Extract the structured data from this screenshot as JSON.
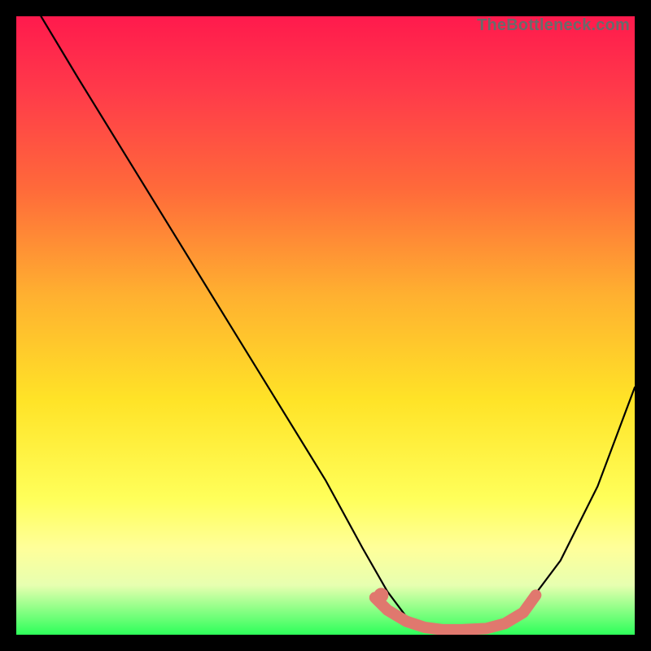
{
  "watermark": "TheBottleneck.com",
  "chart_data": {
    "type": "line",
    "title": "",
    "xlabel": "",
    "ylabel": "",
    "xlim": [
      0,
      100
    ],
    "ylim": [
      0,
      100
    ],
    "series": [
      {
        "name": "curve",
        "x": [
          4,
          10,
          18,
          26,
          34,
          42,
          50,
          56,
          60,
          63,
          66,
          70,
          74,
          78,
          82,
          88,
          94,
          100
        ],
        "y": [
          100,
          90,
          77,
          64,
          51,
          38,
          25,
          14,
          7,
          3,
          1,
          0.5,
          0.5,
          1,
          4,
          12,
          24,
          40
        ]
      }
    ],
    "highlight": {
      "name": "marker-band",
      "color": "#e0786e",
      "x": [
        58,
        60,
        63,
        66,
        69,
        72,
        76,
        79,
        82,
        84
      ],
      "y": [
        6,
        4,
        2.2,
        1.2,
        0.8,
        0.8,
        1.0,
        1.8,
        3.6,
        6.4
      ]
    },
    "highlight_dot": {
      "x": 59,
      "y": 6.4
    },
    "background": {
      "type": "vertical-gradient",
      "stops": [
        {
          "pos": 0.0,
          "color": "#ff1a4d"
        },
        {
          "pos": 0.45,
          "color": "#ffb030"
        },
        {
          "pos": 0.78,
          "color": "#ffff5a"
        },
        {
          "pos": 1.0,
          "color": "#2dff5a"
        }
      ]
    }
  }
}
